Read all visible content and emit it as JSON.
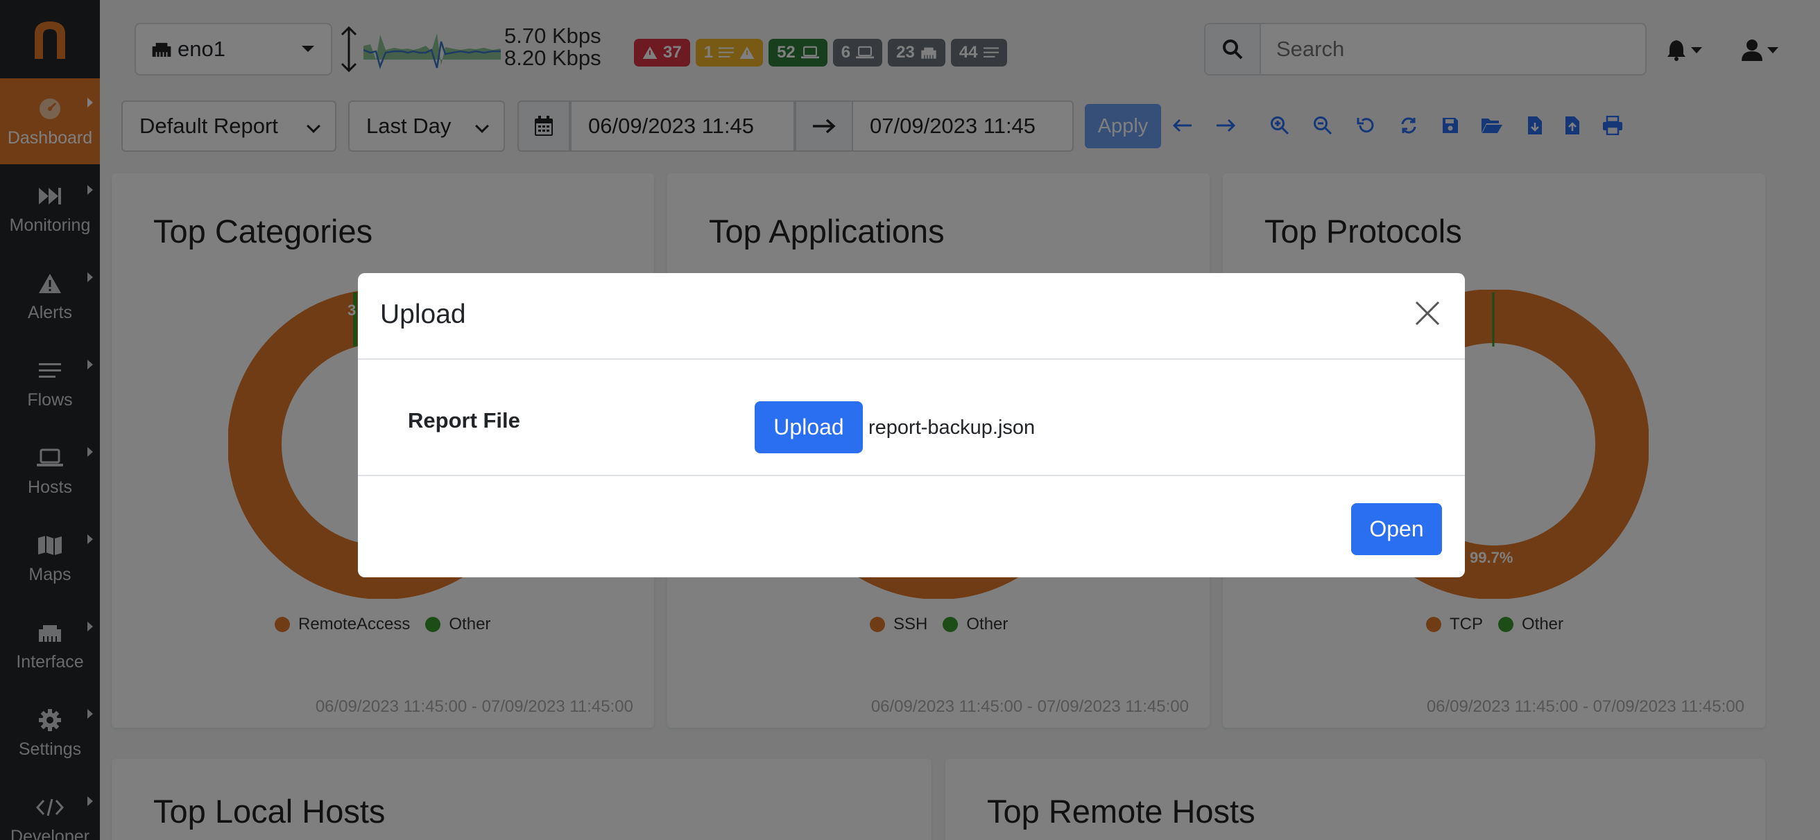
{
  "app": {
    "logo_icon": "ntopng-logo-icon"
  },
  "sidebar": {
    "items": [
      {
        "label": "Dashboard",
        "icon": "gauge-icon",
        "active": true
      },
      {
        "label": "Monitoring",
        "icon": "fast-forward-icon"
      },
      {
        "label": "Alerts",
        "icon": "warning-icon"
      },
      {
        "label": "Flows",
        "icon": "bars-icon"
      },
      {
        "label": "Hosts",
        "icon": "laptop-icon"
      },
      {
        "label": "Maps",
        "icon": "map-icon"
      },
      {
        "label": "Interface",
        "icon": "ethernet-icon"
      },
      {
        "label": "Settings",
        "icon": "gear-icon"
      },
      {
        "label": "Developer",
        "icon": "code-icon"
      }
    ]
  },
  "topbar": {
    "interface": "eno1",
    "rate_up": "5.70 Kbps",
    "rate_down": "8.20 Kbps",
    "badges": [
      {
        "text": "37",
        "icon": "warning-icon",
        "color": "#dc3545"
      },
      {
        "text": "1",
        "icon": "flows-warning-icon",
        "color": "#f0b429"
      },
      {
        "text": "52",
        "icon": "laptop-icon",
        "color": "#2e7d3b"
      },
      {
        "text": "6",
        "icon": "laptop-icon",
        "color": "#6c757d"
      },
      {
        "text": "23",
        "icon": "ethernet-icon",
        "color": "#6c757d"
      },
      {
        "text": "44",
        "icon": "bars-icon",
        "color": "#6c757d"
      }
    ],
    "search_placeholder": "Search"
  },
  "toolbar": {
    "report": "Default Report",
    "period": "Last Day",
    "date_from": "06/09/2023 11:45",
    "date_to": "07/09/2023 11:45",
    "apply": "Apply"
  },
  "cards": {
    "categories": {
      "title": "Top Categories",
      "legend": [
        "RemoteAccess",
        "Other"
      ],
      "visible_label": "3",
      "range": "06/09/2023 11:45:00 - 07/09/2023 11:45:00"
    },
    "applications": {
      "title": "Top Applications",
      "legend": [
        "SSH",
        "Other"
      ],
      "range": "06/09/2023 11:45:00 - 07/09/2023 11:45:00"
    },
    "protocols": {
      "title": "Top Protocols",
      "legend": [
        "TCP",
        "Other"
      ],
      "slice_label": "99.7%",
      "range": "06/09/2023 11:45:00 - 07/09/2023 11:45:00"
    },
    "local_hosts": {
      "title": "Top Local Hosts"
    },
    "remote_hosts": {
      "title": "Top Remote Hosts"
    }
  },
  "colors": {
    "orange": "#e0792c",
    "green": "#3b9a2f",
    "primary": "#2a6ff0"
  },
  "modal": {
    "title": "Upload",
    "field_label": "Report File",
    "upload_button": "Upload",
    "file_name": "report-backup.json",
    "open_button": "Open"
  }
}
